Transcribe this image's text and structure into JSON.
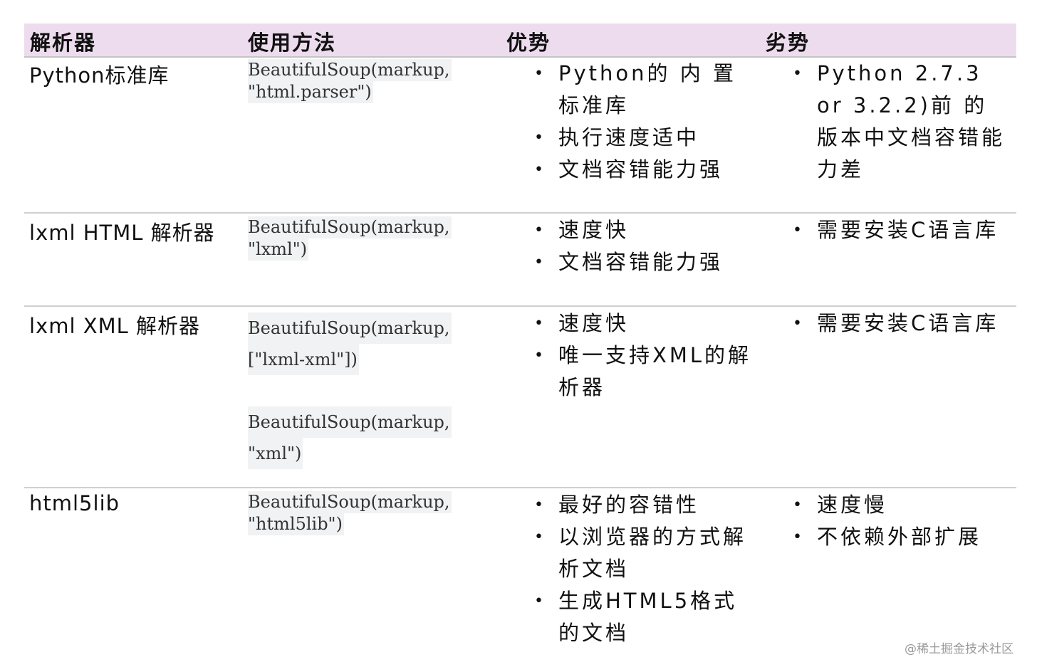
{
  "header": {
    "col1": "解析器",
    "col2": "使用方法",
    "col3": "优势",
    "col4": "劣势"
  },
  "rows": [
    {
      "name": "Python标准库",
      "code": [
        "BeautifulSoup(markup,",
        "\"html.parser\")"
      ],
      "pros": [
        "Python的 内 置 标准库",
        "执行速度适中",
        "文档容错能力强"
      ],
      "cons": [
        "Python 2.7.3 or 3.2.2)前 的版本中文档容错能力差"
      ]
    },
    {
      "name": "lxml HTML 解析器",
      "code": [
        "BeautifulSoup(markup,",
        "\"lxml\")"
      ],
      "pros": [
        "速度快",
        "文档容错能力强"
      ],
      "cons": [
        "需要安装C语言库"
      ]
    },
    {
      "name": "lxml XML 解析器",
      "code": [
        "BeautifulSoup(markup,",
        "[\"lxml-xml\"])",
        "BeautifulSoup(markup,",
        "\"xml\")"
      ],
      "pros": [
        "速度快",
        "唯一支持XML的解析器"
      ],
      "cons": [
        "需要安装C语言库"
      ]
    },
    {
      "name": "html5lib",
      "code": [
        "BeautifulSoup(markup,",
        "\"html5lib\")"
      ],
      "pros": [
        "最好的容错性",
        "以浏览器的方式解析文档",
        "生成HTML5格式的文档"
      ],
      "cons": [
        "速度慢",
        "不依赖外部扩展"
      ]
    }
  ],
  "bullet": "•",
  "watermark": "@稀土掘金技术社区",
  "colors": {
    "header_bg": "#eddcee",
    "code_bg": "#f0f2f3",
    "divider": "#cfcfcf"
  }
}
